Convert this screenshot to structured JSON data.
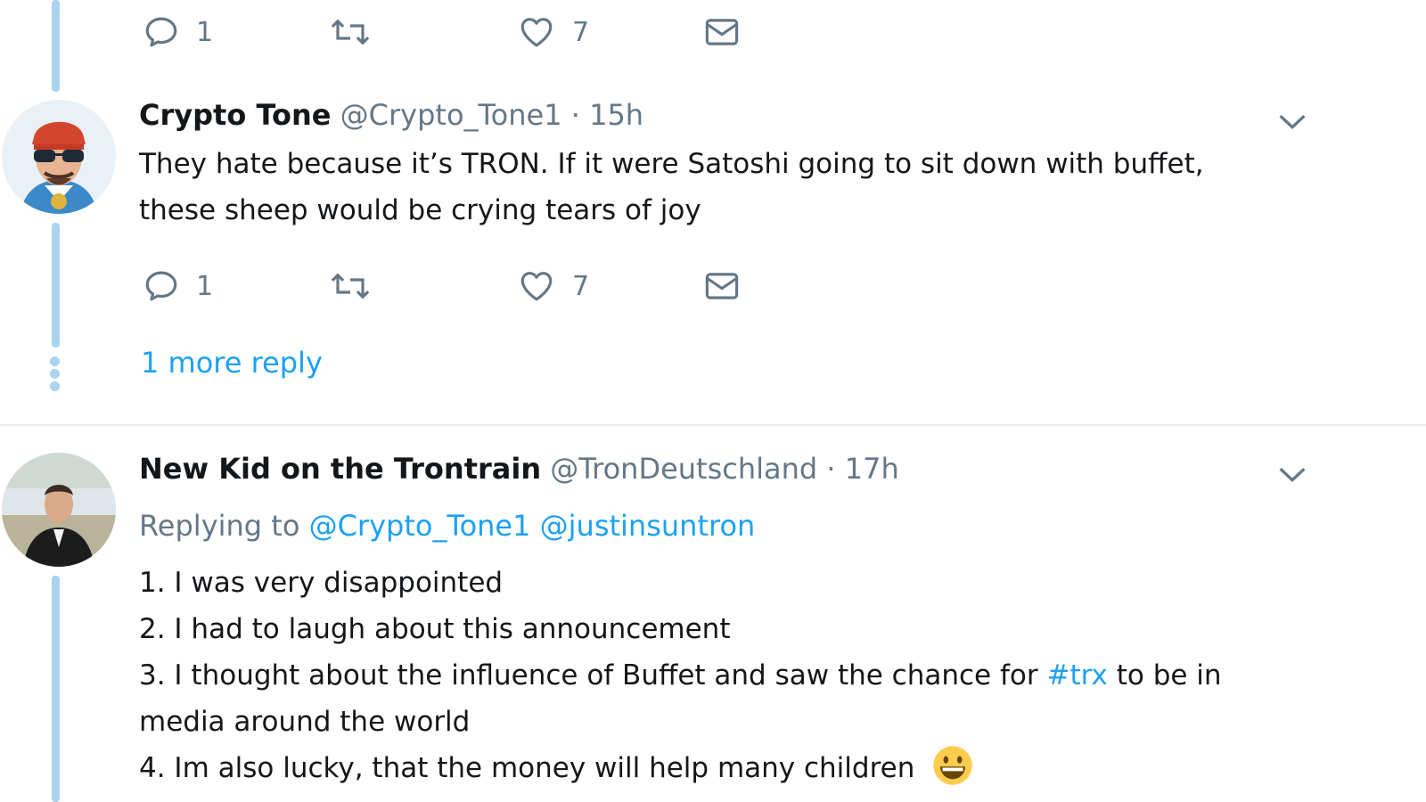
{
  "colors": {
    "accent": "#1da1f2",
    "muted": "#657786",
    "thread_line": "#a8d4f0",
    "text": "#14171a"
  },
  "top_actions": {
    "reply_count": "1",
    "like_count": "7"
  },
  "tweet1": {
    "name": "Crypto Tone",
    "handle": "@Crypto_Tone1",
    "separator": "·",
    "time": "15h",
    "text_line1": "They hate because it’s TRON. If it were Satoshi going to sit down with buffet,",
    "text_line2": "these sheep would be crying tears of joy",
    "reply_count": "1",
    "like_count": "7",
    "avatar_icon": "avatar-sunglasses-cap",
    "caret_icon": "chevron-down-icon"
  },
  "more_replies": "1 more reply",
  "tweet2": {
    "name": "New Kid on the Trontrain",
    "handle": "@TronDeutschland",
    "separator": "·",
    "time": "17h",
    "replying_prefix": "Replying to",
    "reply_to_1": "@Crypto_Tone1",
    "reply_to_2": "@justinsuntron",
    "line1": "1. I was very disappointed",
    "line2": "2. I had to laugh about this announcement",
    "line3_pre": "3. I thought about the influence of Buffet and saw the chance for",
    "line3_tag": "#trx",
    "line3_post": "to be in",
    "line4": "media around the world",
    "line5": "4. Im also lucky, that the money will help many children",
    "emoji_icon": "grinning-face-emoji",
    "avatar_icon": "avatar-person-photo"
  }
}
